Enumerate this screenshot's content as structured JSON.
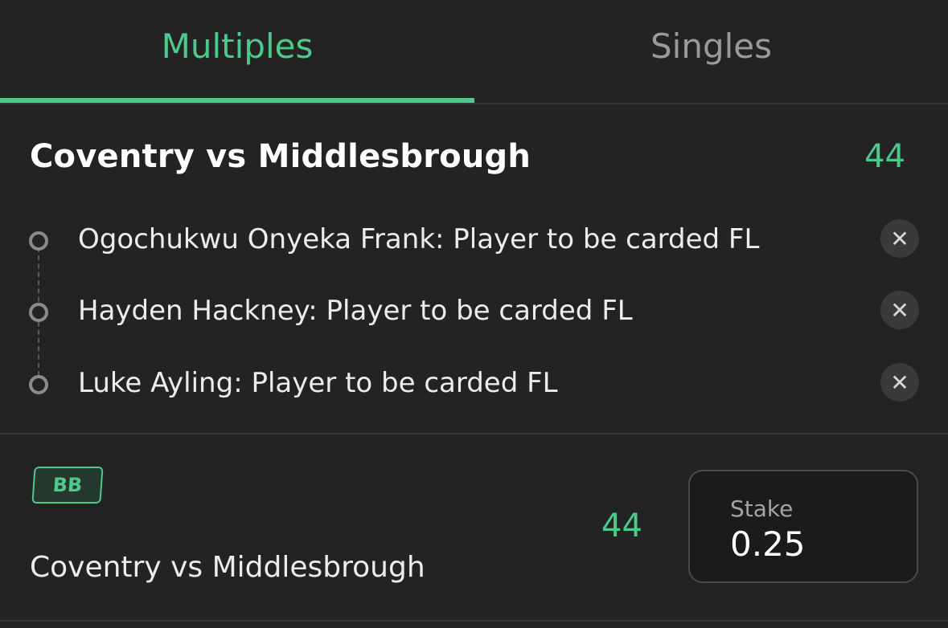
{
  "tabs": [
    {
      "label": "Multiples",
      "active": true
    },
    {
      "label": "Singles",
      "active": false
    }
  ],
  "event": {
    "title": "Coventry vs Middlesbrough",
    "odds": "44"
  },
  "selections": [
    {
      "label": "Ogochukwu Onyeka Frank: Player to be carded FL"
    },
    {
      "label": "Hayden Hackney: Player to be carded FL"
    },
    {
      "label": "Luke Ayling: Player to be carded FL"
    }
  ],
  "icons": {
    "remove": "close-icon",
    "bullet": "timeline-dot-icon"
  },
  "bet": {
    "badge": "BB",
    "title": "Coventry vs Middlesbrough",
    "odds": "44",
    "stake_label": "Stake",
    "stake_value": "0.25"
  },
  "colors": {
    "accent": "#4cc98b",
    "background": "#232323",
    "inactive_text": "#9a9a9a"
  }
}
